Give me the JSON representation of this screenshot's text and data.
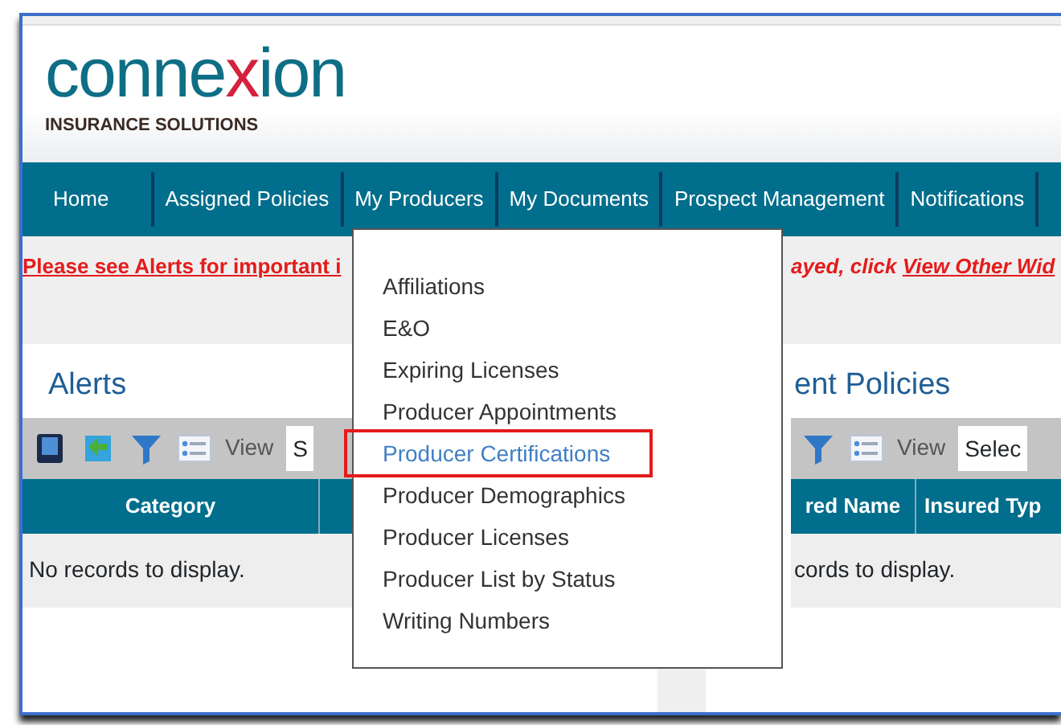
{
  "logo": {
    "parts": [
      {
        "text": "conne",
        "color": "#0e6e86"
      },
      {
        "text": "x",
        "color": "#d4213d"
      },
      {
        "text": "ion",
        "color": "#0e6e86"
      }
    ],
    "tagline": "INSURANCE SOLUTIONS"
  },
  "nav": [
    {
      "label": "Home"
    },
    {
      "label": "Assigned Policies"
    },
    {
      "label": "My Producers",
      "expanded": true
    },
    {
      "label": "My Documents"
    },
    {
      "label": "Prospect Management"
    },
    {
      "label": "Notifications"
    }
  ],
  "dropdown": [
    {
      "label": "Affiliations",
      "selected": false
    },
    {
      "label": "E&O",
      "selected": false
    },
    {
      "label": "Expiring Licenses",
      "selected": false
    },
    {
      "label": "Producer Appointments",
      "selected": false
    },
    {
      "label": "Producer Certifications",
      "selected": true
    },
    {
      "label": "Producer Demographics",
      "selected": false
    },
    {
      "label": "Producer Licenses",
      "selected": false
    },
    {
      "label": "Producer List by Status",
      "selected": false
    },
    {
      "label": "Writing Numbers",
      "selected": false
    }
  ],
  "notice": {
    "left": "Please see Alerts for important i",
    "right": "ayed, click ",
    "link": "View Other Wid"
  },
  "panels": [
    {
      "title": "Alerts",
      "view_label": "View",
      "select": "S",
      "columns": [
        "Category"
      ],
      "empty": "No records to display."
    },
    {
      "title": "ent Policies",
      "view_label": "View",
      "select": "Selec",
      "columns": [
        "red Name",
        "Insured Typ"
      ],
      "empty": "cords to display."
    }
  ]
}
